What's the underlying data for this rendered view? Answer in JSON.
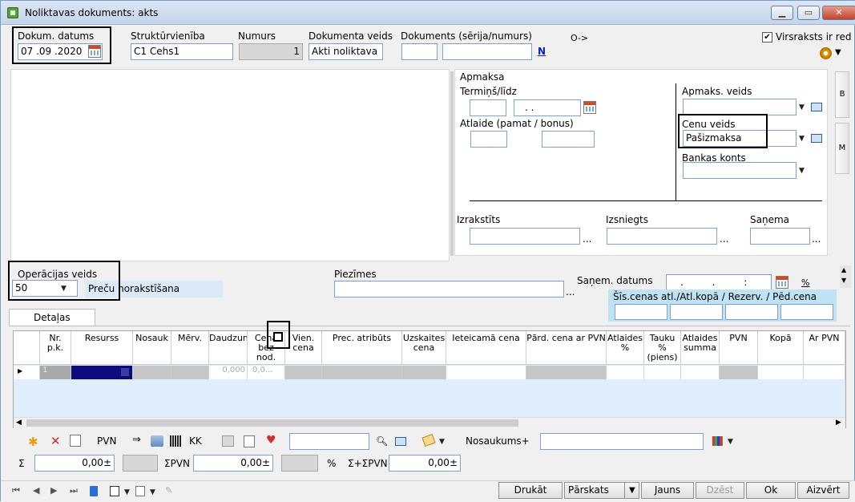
{
  "window": {
    "title": "Noliktavas dokuments: akts",
    "minimize": "▁",
    "maximize": "▭",
    "close": "✕"
  },
  "header": {
    "date_label": "Dokum. datums",
    "date_value": "07 .09 .2020",
    "struct_label": "Struktūrvienība",
    "struct_value": "C1 Cehs1",
    "number_label": "Numurs",
    "number_value": "1",
    "doctype_label": "Dokumenta veids",
    "doctype_value": "Akti noliktava",
    "doc_label": "Dokuments (sērija/numurs)",
    "doc_series": "",
    "doc_number": "",
    "n_link": "N",
    "arrow_text": "O->",
    "virsraksts_label": "Virsraksts ir red",
    "virsraksts_checked": "✔"
  },
  "payment": {
    "section_label": "Apmaksa",
    "term_label": "Termiņš/līdz",
    "term_days": "",
    "term_date": ". .",
    "discount_label": "Atlaide (pamat / bonus)",
    "discount_base": "",
    "discount_bonus": "",
    "pay_type_label": "Apmaks. veids",
    "pay_type_value": "",
    "price_type_label": "Cenu veids",
    "price_type_value": "Pašizmaksa",
    "bank_label": "Bankas konts",
    "bank_value": "",
    "issued_label": "Izrakstīts",
    "delivered_label": "Izsniegts",
    "received_label": "Saņema",
    "dots": "..."
  },
  "side_tabs": [
    "B",
    "M"
  ],
  "operation": {
    "label": "Operācijas veids",
    "code": "50",
    "name": "Preču norakstīšana",
    "notes_label": "Piezīmes",
    "notes_value": "",
    "recv_date_label": "Saņem. datums",
    "recv_date_value": ". . :",
    "percent": "%",
    "price_panel_label": "Šīs.cenas atl./Atl.kopā / Rezerv. / Pēd.cena"
  },
  "tabs": {
    "details": "Detaļas"
  },
  "grid": {
    "columns": [
      "Nr. p.k.",
      "Resurss",
      "Nosauk",
      "Mērv.",
      "Daudzum",
      "Cena bez nod.",
      "Vien. cena",
      "Prec. atribūts",
      "Uzskaites cena",
      "Ieteicamā cena",
      "Pārd. cena ar PVN",
      "Atlaides %",
      "Tauku % (piens)",
      "Atlaides summa",
      "PVN",
      "Kopā",
      "Ar PVN"
    ],
    "row": {
      "nr": "1",
      "qty": "0,000",
      "price": "0,0..."
    }
  },
  "toolbar": {
    "pvn": "PVN",
    "kk": "KK",
    "search_value": "",
    "nosaukums": "Nosaukums+",
    "filter_value": ""
  },
  "totals": {
    "sigma": "Σ",
    "sum_value": "0,00±",
    "pvn_label": "ΣPVN",
    "pvn_value": "0,00±",
    "percent": "%",
    "total_label": "Σ+ΣPVN",
    "total_value": "0,00±"
  },
  "bottom_buttons": {
    "print": "Drukāt",
    "reports": "Pārskats",
    "new": "Jauns",
    "delete": "Dzēst",
    "ok": "Ok",
    "close": "Aizvērt"
  }
}
